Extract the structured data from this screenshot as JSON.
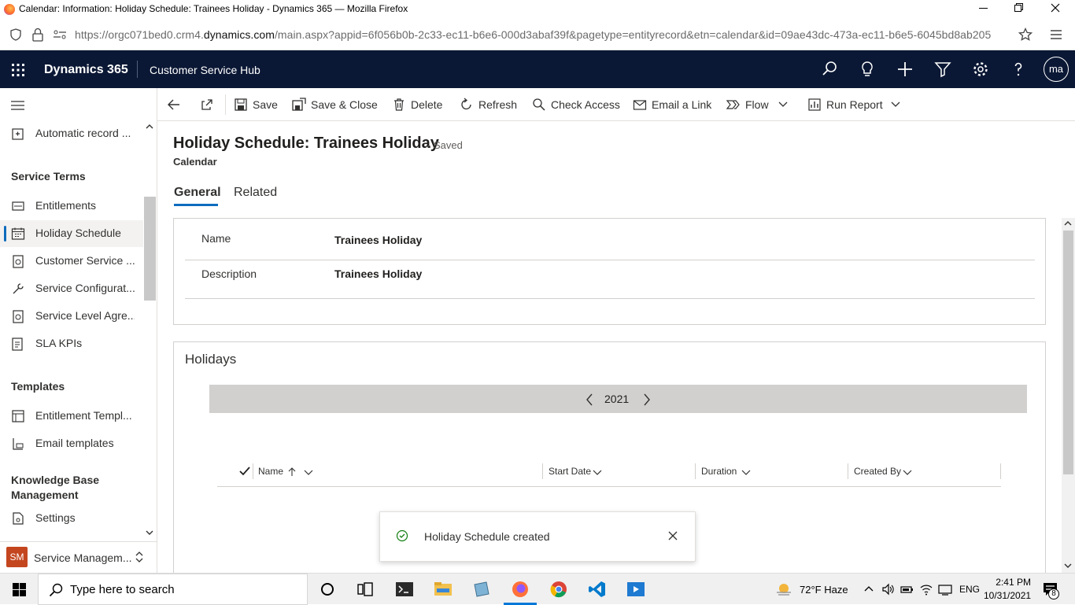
{
  "browser": {
    "window_title": "Calendar: Information: Holiday Schedule: Trainees Holiday - Dynamics 365 — Mozilla Firefox",
    "url_prefix": "https://orgc071bed0.crm4.",
    "url_domain": "dynamics.com",
    "url_rest": "/main.aspx?appid=6f056b0b-2c33-ec11-b6e6-000d3abaf39f&pagetype=entityrecord&etn=calendar&id=09ae43dc-473a-ec11-b6e5-6045bd8ab205"
  },
  "header": {
    "brand": "Dynamics 365",
    "app_name": "Customer Service Hub",
    "avatar_initials": "ma",
    "bg_color": "#0b1835"
  },
  "sidebar": {
    "items_top": [
      {
        "label": "Automatic record ...",
        "icon": "record-creation-icon"
      }
    ],
    "group_service_terms": "Service Terms",
    "service_terms": [
      {
        "label": "Entitlements",
        "icon": "entitlement-icon"
      },
      {
        "label": "Holiday Schedule",
        "icon": "calendar-icon",
        "selected": true
      },
      {
        "label": "Customer Service ...",
        "icon": "schedule-icon"
      },
      {
        "label": "Service Configurat...",
        "icon": "configuration-icon"
      },
      {
        "label": "Service Level Agre...",
        "icon": "sla-icon"
      },
      {
        "label": "SLA KPIs",
        "icon": "kpi-icon"
      }
    ],
    "group_templates": "Templates",
    "templates": [
      {
        "label": "Entitlement Templ...",
        "icon": "template-icon"
      },
      {
        "label": "Email templates",
        "icon": "email-template-icon"
      }
    ],
    "group_kb_line1": "Knowledge Base",
    "group_kb_line2": "Management",
    "kb": [
      {
        "label": "Settings",
        "icon": "settings-doc-icon"
      }
    ],
    "area_badge": "SM",
    "area_label": "Service Managem...",
    "area_color": "#c4461f"
  },
  "commands": {
    "save": "Save",
    "save_close": "Save & Close",
    "delete": "Delete",
    "refresh": "Refresh",
    "check_access": "Check Access",
    "email_link": "Email a Link",
    "flow": "Flow",
    "run_report": "Run Report"
  },
  "form": {
    "title": "Holiday Schedule: Trainees Holiday",
    "saved": "- Saved",
    "entity": "Calendar",
    "tabs": [
      "General",
      "Related"
    ],
    "fields": [
      {
        "label": "Name",
        "value": "Trainees Holiday"
      },
      {
        "label": "Description",
        "value": "Trainees Holiday"
      }
    ],
    "holidays": {
      "title": "Holidays",
      "year": "2021",
      "columns": [
        "Name",
        "Start Date",
        "Duration",
        "Created By"
      ]
    }
  },
  "toast": {
    "message": "Holiday Schedule created",
    "status_color": "#107c10"
  },
  "taskbar": {
    "search_placeholder": "Type here to search",
    "weather": "72°F  Haze",
    "language": "ENG",
    "time": "2:41 PM",
    "date": "10/31/2021",
    "notification_count": "8"
  }
}
